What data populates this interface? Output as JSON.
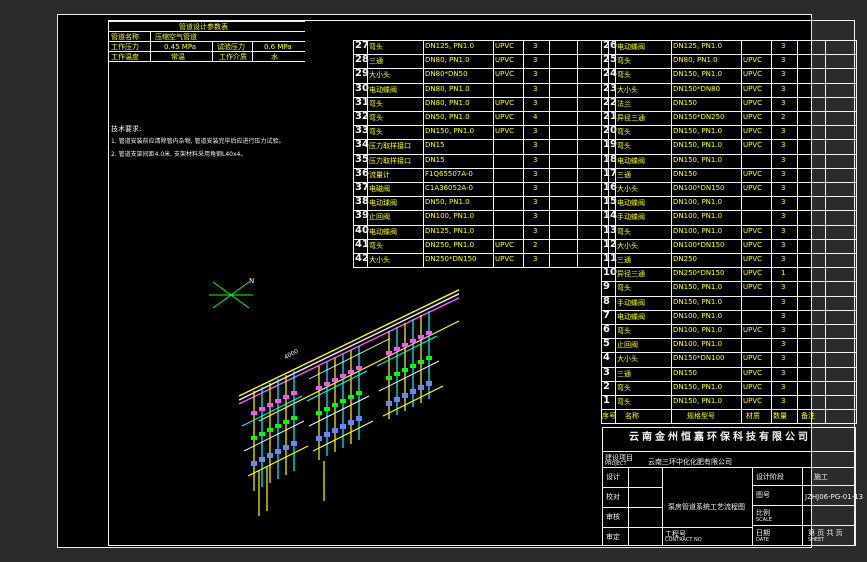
{
  "drawing": {
    "left_table": {
      "title": "管道设计参数表",
      "rows": [
        [
          "管道名称",
          "压缩空气管道",
          "",
          ""
        ],
        [
          "工作压力",
          "0.45 MPa",
          "试验压力",
          "0.6 MPa"
        ],
        [
          "工作温度",
          "常温",
          "工作介质",
          "水"
        ]
      ]
    },
    "notes": {
      "heading": "技术要求:",
      "lines": [
        "1. 管道安装前应清除管内杂物, 管道安装完毕后应进行压力试验。",
        "2. 管道支架间距4.0米, 支架材料采用角钢L40x4。"
      ]
    },
    "north": "N",
    "dim_label": "4000",
    "bom_left": [
      {
        "no": "27",
        "name": "弯头",
        "spec": "DN125, PN1.0",
        "mat": "UPVC",
        "qty": "3"
      },
      {
        "no": "28",
        "name": "三通",
        "spec": "DN80, PN1.0",
        "mat": "UPVC",
        "qty": "3"
      },
      {
        "no": "29",
        "name": "大小头",
        "spec": "DN80*DN50",
        "mat": "UPVC",
        "qty": "3"
      },
      {
        "no": "30",
        "name": "电动蝶阀",
        "spec": "DN80, PN1.0",
        "mat": "",
        "qty": "3"
      },
      {
        "no": "31",
        "name": "弯头",
        "spec": "DN80, PN1.0",
        "mat": "UPVC",
        "qty": "3"
      },
      {
        "no": "32",
        "name": "弯头",
        "spec": "DN50, PN1.0",
        "mat": "UPVC",
        "qty": "4"
      },
      {
        "no": "33",
        "name": "弯头",
        "spec": "DN150, PN1.0",
        "mat": "UPVC",
        "qty": "3"
      },
      {
        "no": "34",
        "name": "压力取样接口",
        "spec": "DN15",
        "mat": "",
        "qty": "3"
      },
      {
        "no": "35",
        "name": "压力取样接口",
        "spec": "DN15",
        "mat": "",
        "qty": "3"
      },
      {
        "no": "36",
        "name": "流量计",
        "spec": "F1Q65507A-0",
        "mat": "",
        "qty": "3"
      },
      {
        "no": "37",
        "name": "电磁阀",
        "spec": "C1A36052A-0",
        "mat": "",
        "qty": "3"
      },
      {
        "no": "38",
        "name": "电动球阀",
        "spec": "DN50, PN1.0",
        "mat": "",
        "qty": "3"
      },
      {
        "no": "39",
        "name": "止回阀",
        "spec": "DN100, PN1.0",
        "mat": "",
        "qty": "3"
      },
      {
        "no": "40",
        "name": "电动蝶阀",
        "spec": "DN125, PN1.0",
        "mat": "",
        "qty": "3"
      },
      {
        "no": "41",
        "name": "弯头",
        "spec": "DN250, PN1.0",
        "mat": "UPVC",
        "qty": "2"
      },
      {
        "no": "42",
        "name": "大小头",
        "spec": "DN250*DN150",
        "mat": "UPVC",
        "qty": "3"
      }
    ],
    "bom_right": [
      {
        "no": "26",
        "name": "电动蝶阀",
        "spec": "DN125, PN1.0",
        "mat": "",
        "qty": "3"
      },
      {
        "no": "25",
        "name": "弯头",
        "spec": "DN80, PN1.0",
        "mat": "UPVC",
        "qty": "3"
      },
      {
        "no": "24",
        "name": "弯头",
        "spec": "DN150, PN1.0",
        "mat": "UPVC",
        "qty": "3"
      },
      {
        "no": "23",
        "name": "大小头",
        "spec": "DN150*DN80",
        "mat": "UPVC",
        "qty": "3"
      },
      {
        "no": "22",
        "name": "法兰",
        "spec": "DN150",
        "mat": "UPVC",
        "qty": "3"
      },
      {
        "no": "21",
        "name": "异径三通",
        "spec": "DN150*DN250",
        "mat": "UPVC",
        "qty": "2"
      },
      {
        "no": "20",
        "name": "弯头",
        "spec": "DN150, PN1.0",
        "mat": "UPVC",
        "qty": "3"
      },
      {
        "no": "19",
        "name": "弯头",
        "spec": "DN150, PN1.0",
        "mat": "UPVC",
        "qty": "3"
      },
      {
        "no": "18",
        "name": "电动蝶阀",
        "spec": "DN150, PN1.0",
        "mat": "",
        "qty": "3"
      },
      {
        "no": "17",
        "name": "三通",
        "spec": "DN150",
        "mat": "UPVC",
        "qty": "3"
      },
      {
        "no": "16",
        "name": "大小头",
        "spec": "DN100*DN150",
        "mat": "UPVC",
        "qty": "3"
      },
      {
        "no": "15",
        "name": "电动蝶阀",
        "spec": "DN100, PN1.0",
        "mat": "",
        "qty": "3"
      },
      {
        "no": "14",
        "name": "手动蝶阀",
        "spec": "DN100, PN1.0",
        "mat": "",
        "qty": "3"
      },
      {
        "no": "13",
        "name": "弯头",
        "spec": "DN100, PN1.0",
        "mat": "UPVC",
        "qty": "3"
      },
      {
        "no": "12",
        "name": "大小头",
        "spec": "DN100*DN150",
        "mat": "UPVC",
        "qty": "3"
      },
      {
        "no": "11",
        "name": "三通",
        "spec": "DN250",
        "mat": "UPVC",
        "qty": "3"
      },
      {
        "no": "10",
        "name": "异径三通",
        "spec": "DN250*DN150",
        "mat": "UPVC",
        "qty": "1"
      },
      {
        "no": "9",
        "name": "弯头",
        "spec": "DN150, PN1.0",
        "mat": "UPVC",
        "qty": "3"
      },
      {
        "no": "8",
        "name": "手动蝶阀",
        "spec": "DN150, PN1.0",
        "mat": "",
        "qty": "3"
      },
      {
        "no": "7",
        "name": "电动蝶阀",
        "spec": "DN100, PN1.0",
        "mat": "",
        "qty": "3"
      },
      {
        "no": "6",
        "name": "弯头",
        "spec": "DN100, PN1.0",
        "mat": "UPVC",
        "qty": "3"
      },
      {
        "no": "5",
        "name": "止回阀",
        "spec": "DN100, PN1.0",
        "mat": "",
        "qty": "3"
      },
      {
        "no": "4",
        "name": "大小头",
        "spec": "DN150*DN100",
        "mat": "UPVC",
        "qty": "3"
      },
      {
        "no": "3",
        "name": "三通",
        "spec": "DN150",
        "mat": "UPVC",
        "qty": "3"
      },
      {
        "no": "2",
        "name": "弯头",
        "spec": "DN150, PN1.0",
        "mat": "UPVC",
        "qty": "3"
      },
      {
        "no": "1",
        "name": "弯头",
        "spec": "DN150, PN1.0",
        "mat": "UPVC",
        "qty": "3"
      }
    ],
    "bom_header": [
      "序号",
      "名称",
      "规格型号",
      "材质",
      "数量",
      "备注"
    ],
    "title_block": {
      "company": "云南金州恒嘉环保科技有限公司",
      "project_label": "建设项目",
      "project_label_en": "PROJECT",
      "project_name": "云南三环中化化肥有限公司",
      "drawing_title": "泵房管道系统工艺流程图",
      "rows_left": [
        "设计",
        "校对",
        "审核",
        "审定"
      ],
      "stage_label": "设计阶段",
      "stage_value": "施工",
      "drawing_no_label": "图号",
      "drawing_no": "JZHJ06-PG-01-13",
      "scale_label": "比例",
      "scale_en": "SCALE",
      "date_label": "日期",
      "date_en": "DATE",
      "sheet_label": "第 页 共 页",
      "sheet_en": "SHEET",
      "proj_no_label": "工程号",
      "proj_no_en": "CONTRACT NO"
    }
  }
}
